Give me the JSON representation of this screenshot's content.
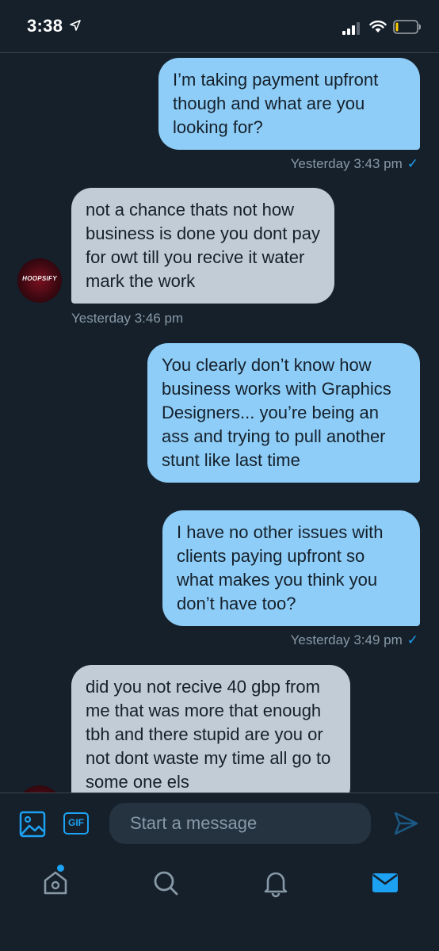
{
  "status_bar": {
    "time": "3:38",
    "icons": [
      "location-arrow-icon",
      "signal-icon",
      "wifi-icon",
      "battery-icon"
    ]
  },
  "messages": [
    {
      "direction": "out",
      "text": "I’m taking payment upfront though and what are you looking for?"
    },
    {
      "direction": "out_stamp",
      "text": "Yesterday 3:43 pm",
      "check": "✓"
    },
    {
      "direction": "in",
      "text": "not a chance thats not how business is done you dont pay for owt till you recive it water mark the work"
    },
    {
      "direction": "in_stamp",
      "text": "Yesterday 3:46 pm"
    },
    {
      "direction": "out",
      "text": "You clearly don’t know how business works with Graphics Designers... you’re being an ass and trying to pull another stunt  like last time"
    },
    {
      "direction": "out",
      "text": "I have no other issues with clients paying upfront so what makes you think you don’t have too?"
    },
    {
      "direction": "out_stamp",
      "text": "Yesterday 3:49 pm",
      "check": "✓"
    },
    {
      "direction": "in",
      "text": "did you not recive 40 gbp from me that was more that enough tbh and there stupid are you or not dont waste my time all go to some one els"
    }
  ],
  "avatar": {
    "label": "HOOPSIFY"
  },
  "composer": {
    "gif_label": "GIF",
    "placeholder": "Start a message",
    "icons": [
      "image-icon",
      "send-icon"
    ]
  },
  "tabbar": {
    "items": [
      "home-icon",
      "search-icon",
      "notifications-icon",
      "messages-icon"
    ],
    "active": "messages-icon"
  },
  "colors": {
    "background": "#15202b",
    "outgoing_bubble": "#8ecdf7",
    "incoming_bubble": "#c1ccd6",
    "accent": "#1da1f2",
    "muted_text": "#8899a6"
  }
}
